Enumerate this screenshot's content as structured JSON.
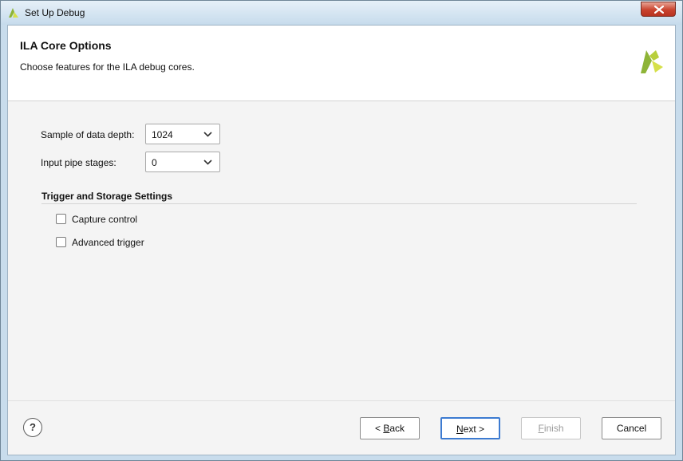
{
  "window": {
    "title": "Set Up Debug"
  },
  "header": {
    "title": "ILA Core Options",
    "subtitle": "Choose features for the ILA debug cores."
  },
  "form": {
    "depth_label": "Sample of data depth:",
    "depth_value": "1024",
    "pipe_label": "Input pipe stages:",
    "pipe_value": "0"
  },
  "trigger_section": {
    "title": "Trigger and Storage Settings",
    "options": [
      {
        "label": "Capture control",
        "checked": false
      },
      {
        "label": "Advanced trigger",
        "checked": false
      }
    ]
  },
  "footer": {
    "help_label": "?",
    "back_prefix": "< ",
    "back_mnemonic": "B",
    "back_rest": "ack",
    "next_mnemonic": "N",
    "next_rest": "ext >",
    "finish_mnemonic": "F",
    "finish_rest": "inish",
    "cancel_label": "Cancel"
  },
  "colors": {
    "brand_green": "#8eb437",
    "brand_yellow": "#d6e04a",
    "primary_border": "#3d7bd1",
    "close_red": "#c9432e"
  },
  "icons": {
    "title": "xilinx-logo-icon",
    "brand": "xilinx-logo-icon",
    "close": "close-icon",
    "dropdown": "chevron-down-icon"
  }
}
